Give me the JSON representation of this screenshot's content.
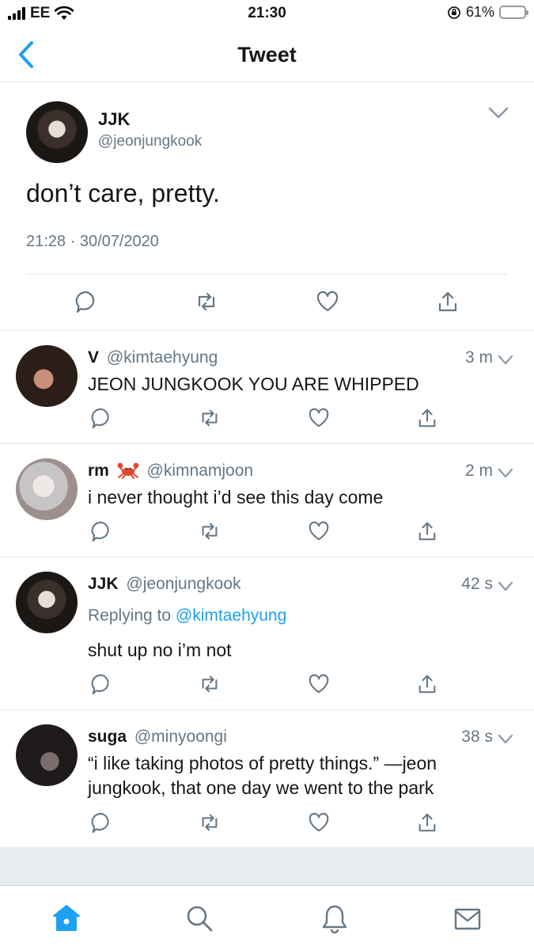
{
  "status_bar": {
    "carrier": "EE",
    "time": "21:30",
    "battery_percent": "61%",
    "battery_level": 0.61
  },
  "header": {
    "title": "Tweet",
    "back_icon": "chevron-left-icon"
  },
  "main_tweet": {
    "name": "JJK",
    "handle": "@jeonjungkook",
    "text": "don’t care, pretty.",
    "timestamp": "21:28 · 30/07/2020"
  },
  "replies": [
    {
      "name": "V",
      "handle": "@kimtaehyung",
      "time": "3 m",
      "text": "JEON JUNGKOOK YOU ARE WHIPPED"
    },
    {
      "name": "rm",
      "emoji": "crab-emoji",
      "handle": "@kimnamjoon",
      "time": "2 m",
      "text": "i never thought i’d see this day come"
    },
    {
      "name": "JJK",
      "handle": "@jeonjungkook",
      "time": "42 s",
      "replying_prefix": "Replying to",
      "replying_to": "@kimtaehyung",
      "text": "shut up no i’m not"
    },
    {
      "name": "suga",
      "handle": "@minyoongi",
      "time": "38 s",
      "text": "“i like taking photos of pretty things.” —jeon jungkook, that one day we went to the park"
    }
  ],
  "tab_bar": {
    "items": [
      "home-icon",
      "search-icon",
      "notifications-icon",
      "messages-icon"
    ],
    "active": "home-icon"
  },
  "colors": {
    "accent": "#1da1f2",
    "secondary_text": "#657786",
    "divider": "#e1e8ed",
    "battery": "#f5c400"
  }
}
